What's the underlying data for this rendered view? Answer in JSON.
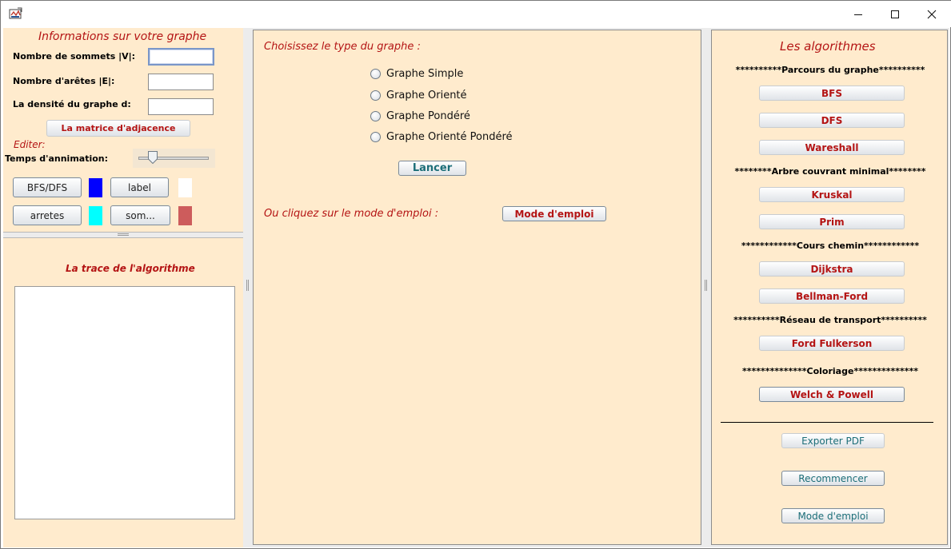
{
  "window": {
    "minimize_label": "Minimize",
    "maximize_label": "Maximize",
    "close_label": "Close"
  },
  "left": {
    "title": "Informations sur votre graphe",
    "fields": [
      {
        "label": "Nombre de sommets |V|:",
        "value": ""
      },
      {
        "label": "Nombre d'arêtes |E|:",
        "value": ""
      },
      {
        "label": "La densité du graphe d:",
        "value": ""
      }
    ],
    "matrix_button": "La matrice d'adjacence",
    "editer_label": "Editer:",
    "animation_label": "Temps d'annimation:",
    "color_buttons": [
      {
        "label": "BFS/DFS",
        "color": "#0000ff"
      },
      {
        "label": "label",
        "color": "#ffffff"
      },
      {
        "label": "arretes",
        "color": "#00ffff"
      },
      {
        "label": "som...",
        "color": "#cd5c5c"
      }
    ],
    "trace_title": "La trace de l'algorithme",
    "trace_text": ""
  },
  "center": {
    "choose_label": "Choisissez le type du graphe :",
    "radio_options": [
      "Graphe Simple",
      "Graphe Orienté",
      "Graphe Pondéré",
      "Graphe Orienté Pondéré"
    ],
    "launch_button": "Lancer",
    "or_label": "Ou cliquez sur le mode d'emploi :",
    "mode_button": "Mode d'emploi"
  },
  "right": {
    "title": "Les algorithmes",
    "sections": [
      {
        "header": "**********Parcours du graphe**********",
        "buttons": [
          "BFS",
          "DFS",
          "Wareshall"
        ]
      },
      {
        "header": "********Arbre couvrant minimal********",
        "buttons": [
          "Kruskal",
          "Prim"
        ]
      },
      {
        "header": "************Cours chemin************",
        "buttons": [
          "Dijkstra",
          "Bellman-Ford"
        ]
      },
      {
        "header": "**********Réseau de transport**********",
        "buttons": [
          "Ford Fulkerson"
        ]
      },
      {
        "header": "**************Coloriage**************",
        "buttons": [
          "Welch & Powell"
        ]
      }
    ],
    "export_button": "Exporter PDF",
    "restart_button": "Recommencer",
    "help_button": "Mode d'emploi"
  },
  "colors": {
    "panel_bg": "#ffebcd",
    "title_red": "#b41414",
    "teal": "#1c6e78"
  }
}
